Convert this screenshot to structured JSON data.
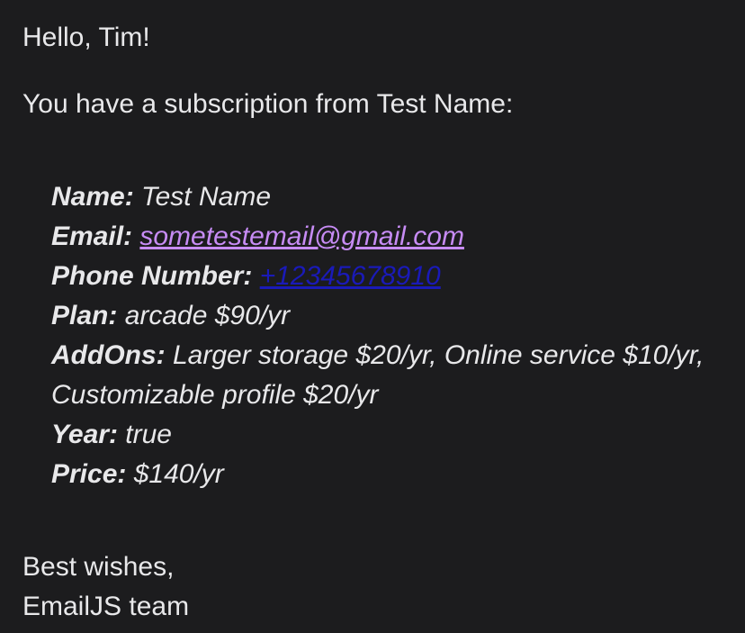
{
  "email": {
    "greeting": "Hello, Tim!",
    "intro": "You have a subscription from Test Name:",
    "details": {
      "name_label": "Name:",
      "name_value": "Test Name",
      "email_label": "Email:",
      "email_value": "sometestemail@gmail.com",
      "phone_label": "Phone Number:",
      "phone_value": "+12345678910",
      "plan_label": "Plan:",
      "plan_value": "arcade $90/yr",
      "addons_label": "AddOns:",
      "addons_value": "Larger storage $20/yr, Online service $10/yr, Customizable profile $20/yr",
      "year_label": "Year:",
      "year_value": "true",
      "price_label": "Price:",
      "price_value": "$140/yr"
    },
    "signoff_line1": "Best wishes,",
    "signoff_line2": "EmailJS team"
  },
  "colors": {
    "background": "#1c1c1e",
    "text": "#e8e8ea",
    "email_link": "#c78cf5",
    "phone_link": "#1a1ab8"
  }
}
